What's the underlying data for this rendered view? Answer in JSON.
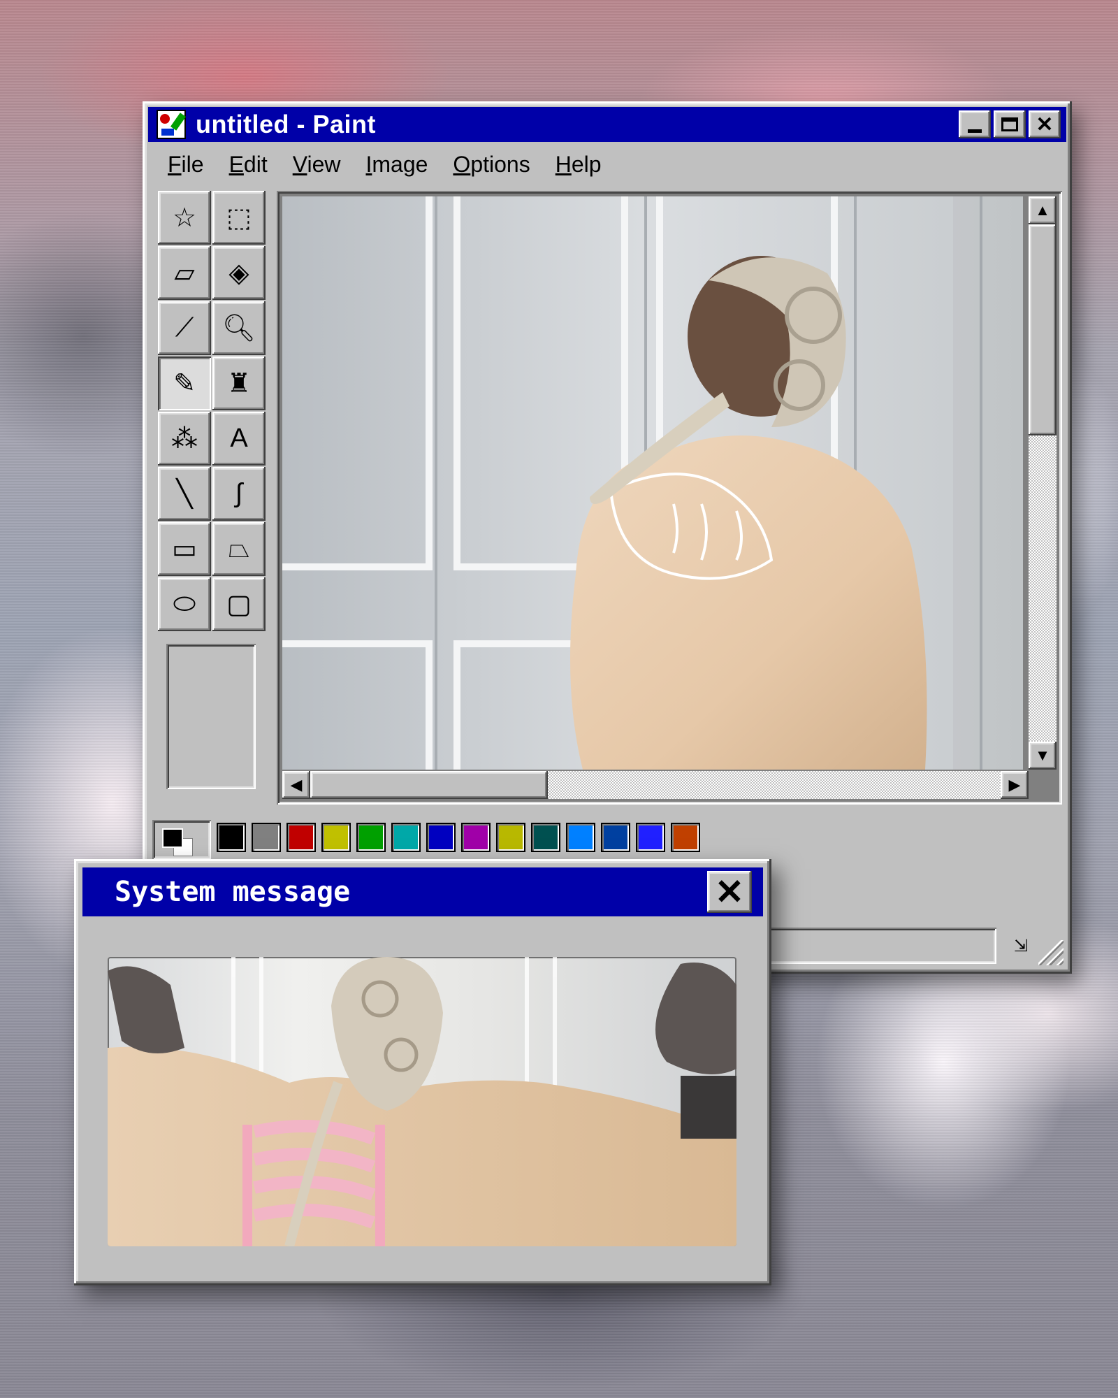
{
  "paint_window": {
    "title": "untitled - Paint",
    "menu": [
      {
        "label": "File",
        "mnemonic": "F",
        "rest": "ile"
      },
      {
        "label": "Edit",
        "mnemonic": "E",
        "rest": "dit"
      },
      {
        "label": "View",
        "mnemonic": "V",
        "rest": "iew"
      },
      {
        "label": "Image",
        "mnemonic": "I",
        "rest": "mage"
      },
      {
        "label": "Options",
        "mnemonic": "O",
        "rest": "ptions"
      },
      {
        "label": "Help",
        "mnemonic": "H",
        "rest": "elp"
      }
    ],
    "window_buttons": {
      "close_glyph": "✕"
    },
    "tools": [
      {
        "name": "free-form-select-icon",
        "glyph": "☆"
      },
      {
        "name": "rect-select-icon",
        "glyph": "⬚"
      },
      {
        "name": "eraser-icon",
        "glyph": "▱"
      },
      {
        "name": "fill-bucket-icon",
        "glyph": "◈"
      },
      {
        "name": "color-picker-icon",
        "glyph": "⟋"
      },
      {
        "name": "magnifier-icon",
        "glyph": "🔍︎"
      },
      {
        "name": "pencil-icon",
        "glyph": "✎"
      },
      {
        "name": "brush-icon",
        "glyph": "♜"
      },
      {
        "name": "airbrush-icon",
        "glyph": "⁂"
      },
      {
        "name": "text-icon",
        "glyph": "A"
      },
      {
        "name": "line-icon",
        "glyph": "╲"
      },
      {
        "name": "curve-icon",
        "glyph": "∫"
      },
      {
        "name": "rectangle-icon",
        "glyph": "▭"
      },
      {
        "name": "polygon-icon",
        "glyph": "⏢"
      },
      {
        "name": "ellipse-icon",
        "glyph": "⬭"
      },
      {
        "name": "rounded-rect-icon",
        "glyph": "▢"
      }
    ],
    "selected_tool": "pencil-icon",
    "palette": [
      "#000000",
      "#808080",
      "#c00000",
      "#c0c000",
      "#00a000",
      "#00a8a8",
      "#0000c0",
      "#a000a8",
      "#b8b800",
      "#005050",
      "#0080ff",
      "#0040a0",
      "#2020ff",
      "#c04000"
    ],
    "scroll_glyphs": {
      "up": "▲",
      "down": "▼",
      "left": "◀",
      "right": "▶"
    },
    "status_icon": "⇲"
  },
  "system_message": {
    "title": "System message",
    "close_glyph": "✕"
  },
  "colors": {
    "title_blue": "#0000a8",
    "face": "#c0c0c0"
  }
}
